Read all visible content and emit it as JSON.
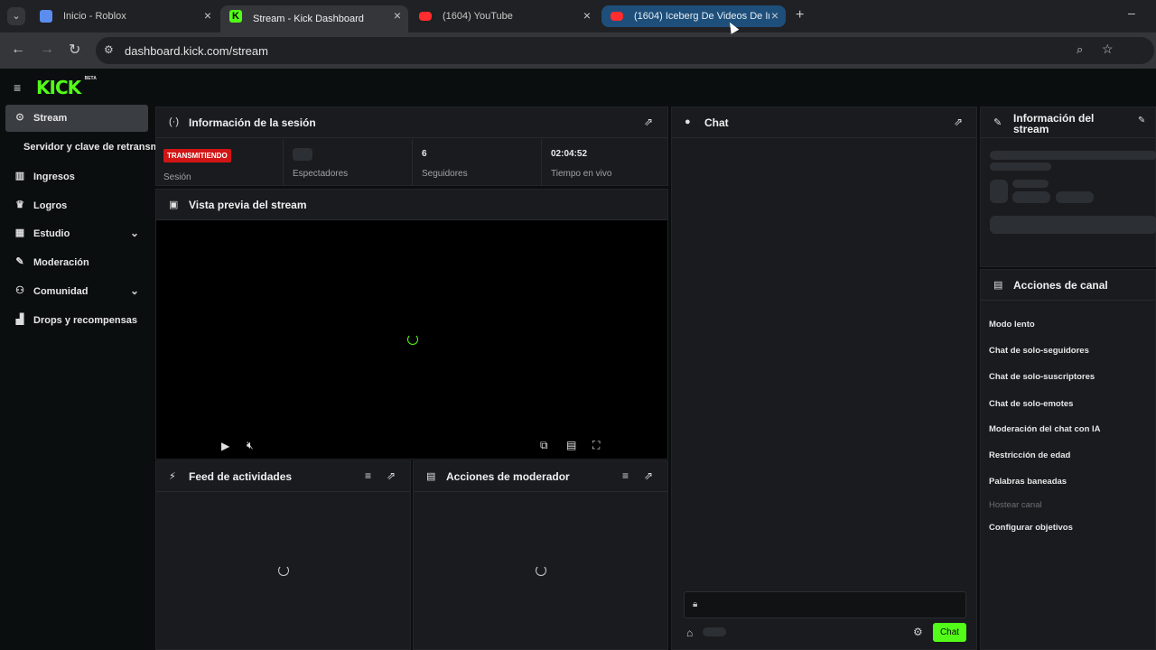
{
  "browser": {
    "tabs": [
      {
        "title": "Inicio - Roblox",
        "active": false
      },
      {
        "title": "Stream - Kick Dashboard",
        "active": true
      },
      {
        "title": "(1604) YouTube",
        "active": false
      },
      {
        "title": "(1604) Iceberg De Videos De In",
        "active": false
      }
    ],
    "url": "dashboard.kick.com/stream"
  },
  "brand": {
    "logo": "KICK",
    "badge": "BETA",
    "accent": "#53fc18"
  },
  "sidebar": {
    "items": [
      {
        "label": "Stream",
        "icon": "broadcast-icon",
        "active": true
      },
      {
        "label": "Servidor y clave de retransmisión",
        "icon": "",
        "sub": true
      },
      {
        "label": "Ingresos",
        "icon": "chart-icon"
      },
      {
        "label": "Logros",
        "icon": "trophy-icon"
      },
      {
        "label": "Estudio",
        "icon": "studio-icon",
        "expandable": true
      },
      {
        "label": "Moderación",
        "icon": "wrench-icon"
      },
      {
        "label": "Comunidad",
        "icon": "people-icon",
        "expandable": true
      },
      {
        "label": "Drops y recompensas",
        "icon": "gift-icon"
      }
    ]
  },
  "session": {
    "title": "Información de la sesión",
    "live_badge": "TRANSMITIENDO",
    "stats": [
      {
        "label": "Sesión",
        "value": ""
      },
      {
        "label": "Espectadores",
        "value": ""
      },
      {
        "label": "Seguidores",
        "value": "6"
      },
      {
        "label": "Tiempo en vivo",
        "value": "02:04:52"
      }
    ]
  },
  "preview": {
    "title": "Vista previa del stream"
  },
  "activity": {
    "title": "Feed de actividades"
  },
  "mod_actions": {
    "title": "Acciones de moderador"
  },
  "chat": {
    "title": "Chat",
    "send_label": "Chat"
  },
  "stream_info": {
    "title": "Información del stream"
  },
  "channel_actions": {
    "title": "Acciones de canal",
    "items": [
      {
        "label": "Modo lento",
        "enabled": true
      },
      {
        "label": "Chat de solo-seguidores",
        "enabled": true
      },
      {
        "label": "Chat de solo-suscriptores",
        "enabled": true
      },
      {
        "label": "Chat de solo-emotes",
        "enabled": true
      },
      {
        "label": "Moderación del chat con IA",
        "enabled": true
      },
      {
        "label": "Restricción de edad",
        "enabled": true
      },
      {
        "label": "Palabras baneadas",
        "enabled": true
      },
      {
        "label": "Hostear canal",
        "enabled": false
      },
      {
        "label": "Configurar objetivos",
        "enabled": true
      }
    ]
  }
}
